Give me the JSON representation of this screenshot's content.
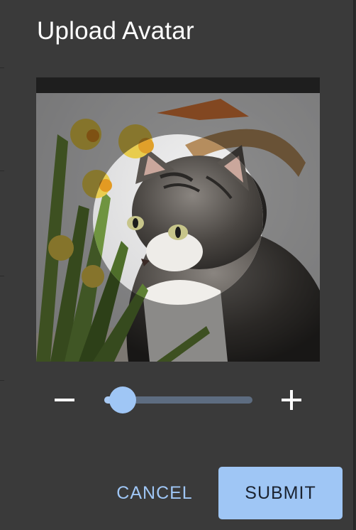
{
  "dialog": {
    "title": "Upload Avatar"
  },
  "cropper": {
    "image_subject": "tabby cat with daffodils",
    "crop_shape": "circle"
  },
  "zoom": {
    "decrease_icon": "minus-icon",
    "increase_icon": "plus-icon",
    "level": 0.1
  },
  "actions": {
    "cancel_label": "CANCEL",
    "submit_label": "SUBMIT"
  },
  "colors": {
    "dialog_bg": "#3a3a3a",
    "accent": "#9fc6f5",
    "slider_track": "#5d6c80",
    "title_text": "#ffffff"
  }
}
